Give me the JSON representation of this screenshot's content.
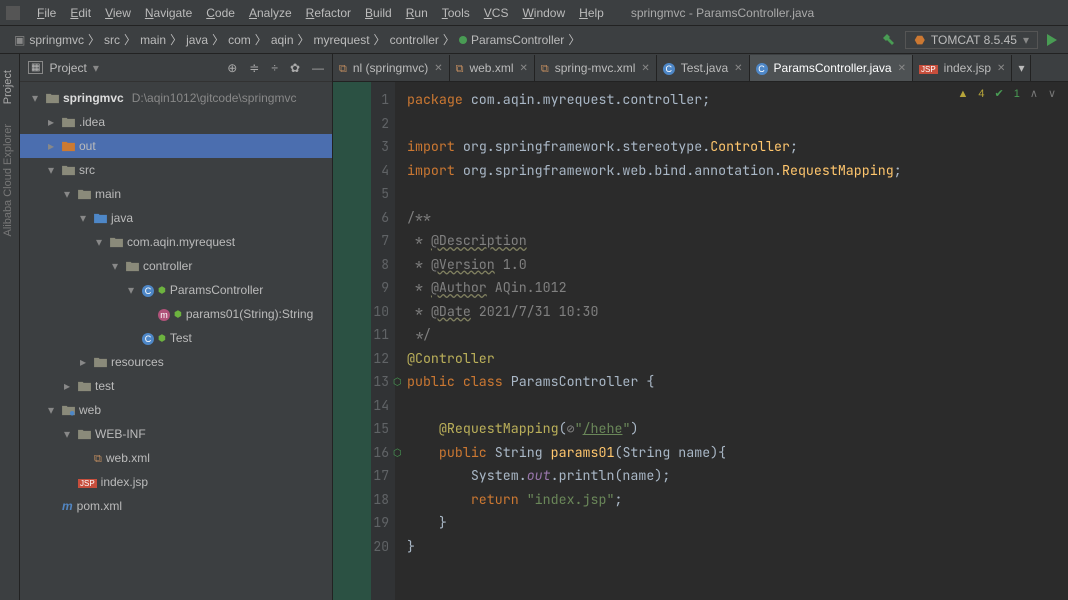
{
  "title": "springmvc - ParamsController.java",
  "menu": [
    "File",
    "Edit",
    "View",
    "Navigate",
    "Code",
    "Analyze",
    "Refactor",
    "Build",
    "Run",
    "Tools",
    "VCS",
    "Window",
    "Help"
  ],
  "breadcrumbs": [
    "springmvc",
    "src",
    "main",
    "java",
    "com",
    "aqin",
    "myrequest",
    "controller",
    "ParamsController"
  ],
  "runconfig": "TOMCAT 8.5.45",
  "side_tabs": [
    {
      "label": "Project",
      "dim": false
    },
    {
      "label": "Alibaba Cloud Explorer",
      "dim": true
    }
  ],
  "panel": {
    "title": "Project"
  },
  "tree": [
    {
      "d": 0,
      "tw": "▾",
      "icon": "folder",
      "label": "springmvc",
      "path": "D:\\aqin1012\\gitcode\\springmvc",
      "bold": true
    },
    {
      "d": 1,
      "tw": "▸",
      "icon": "folder",
      "label": ".idea"
    },
    {
      "d": 1,
      "tw": "▸",
      "icon": "folder-o",
      "label": "out",
      "sel": true
    },
    {
      "d": 1,
      "tw": "▾",
      "icon": "folder",
      "label": "src"
    },
    {
      "d": 2,
      "tw": "▾",
      "icon": "folder",
      "label": "main"
    },
    {
      "d": 3,
      "tw": "▾",
      "icon": "folder-b",
      "label": "java"
    },
    {
      "d": 4,
      "tw": "▾",
      "icon": "folder",
      "label": "com.aqin.myrequest"
    },
    {
      "d": 5,
      "tw": "▾",
      "icon": "folder",
      "label": "controller"
    },
    {
      "d": 6,
      "tw": "▾",
      "icon": "class",
      "label": "ParamsController",
      "spring": true
    },
    {
      "d": 7,
      "tw": " ",
      "icon": "method",
      "label": "params01(String):String",
      "spring": true
    },
    {
      "d": 6,
      "tw": " ",
      "icon": "class",
      "label": "Test",
      "spring": true
    },
    {
      "d": 3,
      "tw": "▸",
      "icon": "folder",
      "label": "resources"
    },
    {
      "d": 2,
      "tw": "▸",
      "icon": "folder",
      "label": "test"
    },
    {
      "d": 1,
      "tw": "▾",
      "icon": "folder-w",
      "label": "web"
    },
    {
      "d": 2,
      "tw": "▾",
      "icon": "folder",
      "label": "WEB-INF"
    },
    {
      "d": 3,
      "tw": " ",
      "icon": "xml",
      "label": "web.xml"
    },
    {
      "d": 2,
      "tw": " ",
      "icon": "jsp",
      "label": "index.jsp"
    },
    {
      "d": 1,
      "tw": " ",
      "icon": "pom",
      "label": "pom.xml"
    }
  ],
  "tabs": [
    {
      "label": "nl (springmvc)",
      "icon": "xml"
    },
    {
      "label": "web.xml",
      "icon": "xml"
    },
    {
      "label": "spring-mvc.xml",
      "icon": "xml"
    },
    {
      "label": "Test.java",
      "icon": "class"
    },
    {
      "label": "ParamsController.java",
      "icon": "class",
      "active": true
    },
    {
      "label": "index.jsp",
      "icon": "jsp"
    }
  ],
  "badges": {
    "warn_label": "4",
    "ok_label": "1"
  },
  "code": {
    "1": {
      "t": "<span class='kw'>package </span><span class='pkg'>com.aqin.myrequest.controller</span><span class='id'>;</span>"
    },
    "2": {
      "t": ""
    },
    "3": {
      "t": "<span class='kw'>import </span><span class='pkg'>org.springframework.stereotype.</span><span class='cls'>Controller</span><span class='id'>;</span>"
    },
    "4": {
      "t": "<span class='kw'>import </span><span class='pkg'>org.springframework.web.bind.annotation.</span><span class='cls'>RequestMapping</span><span class='id'>;</span>"
    },
    "5": {
      "t": ""
    },
    "6": {
      "t": "<span class='cmt'>/**</span>"
    },
    "7": {
      "t": "<span class='cmt'> * </span><span class='tag'>@Description</span>"
    },
    "8": {
      "t": "<span class='cmt'> * </span><span class='tag'>@Version</span><span class='cmt'> 1.0</span>"
    },
    "9": {
      "t": "<span class='cmt'> * </span><span class='tag'>@Author</span><span class='cmt'> AQin.1012</span>"
    },
    "10": {
      "t": "<span class='cmt'> * </span><span class='tag'>@Date</span><span class='cmt'> 2021/7/31 10:30</span>"
    },
    "11": {
      "t": "<span class='cmt'> */</span>"
    },
    "12": {
      "t": "<span class='ann'>@Controller</span>"
    },
    "13": {
      "t": "<span class='kw'>public class </span><span class='id'>ParamsController </span><span class='id'>{</span>",
      "mark": "gmk"
    },
    "14": {
      "t": ""
    },
    "15": {
      "t": "    <span class='ann'>@RequestMapping</span><span class='id'>(</span><span class='cmt'>⊘</span><span class='str'>\"</span><span class='str' style='text-decoration:underline'>/hehe</span><span class='str'>\"</span><span class='id'>)</span>"
    },
    "16": {
      "t": "    <span class='kw'>public </span><span class='id'>String </span><span class='fn'>params01</span><span class='id'>(String name){</span>",
      "mark": "gmk"
    },
    "17": {
      "t": "        <span class='id'>System.</span><span class='id' style='font-style:italic;color:#9876aa'>out</span><span class='id'>.println(name);</span>"
    },
    "18": {
      "t": "        <span class='kw'>return </span><span class='str'>\"index.jsp\"</span><span class='id'>;</span>"
    },
    "19": {
      "t": "    <span class='id'>}</span>"
    },
    "20": {
      "t": "<span class='id'>}</span>"
    }
  }
}
